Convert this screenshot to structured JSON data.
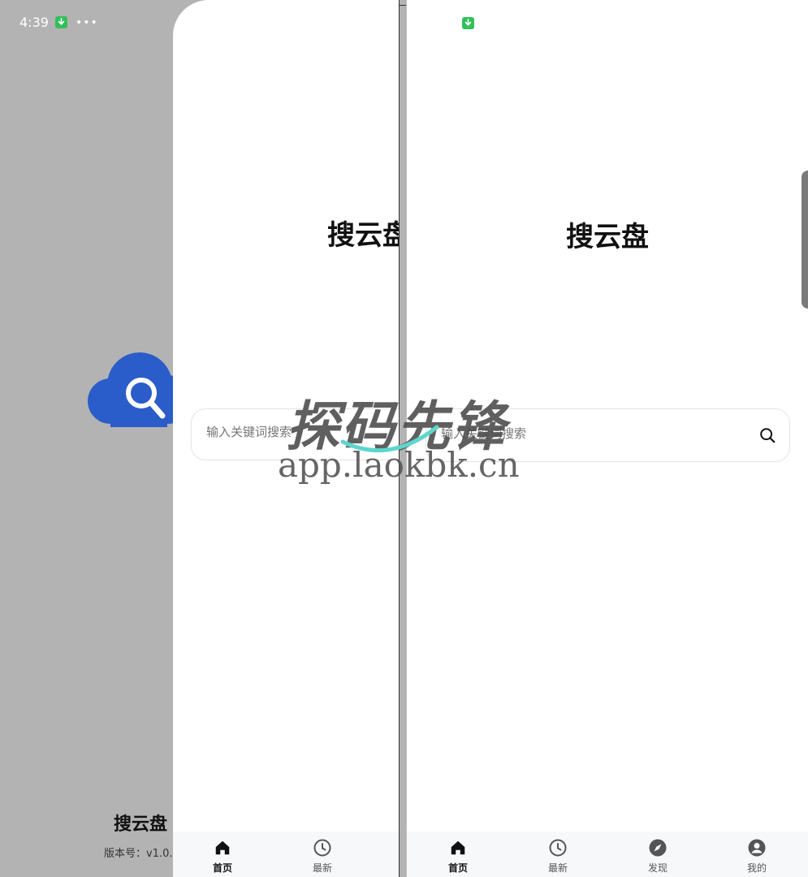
{
  "status_bar": {
    "time": "4:39",
    "download_icon": "download-icon",
    "more_icon": "more-dots-icon"
  },
  "splash": {
    "app_name": "搜云盘",
    "version_label": "版本号：v1.0.",
    "logo_icon": "cloud-search-icon",
    "logo_color": "#2a5dc9"
  },
  "app": {
    "title": "搜云盘",
    "search": {
      "placeholder": "输入关键词搜索",
      "value": ""
    },
    "nav": [
      {
        "label": "首页",
        "icon": "home-icon"
      },
      {
        "label": "最新",
        "icon": "clock-icon"
      },
      {
        "label": "发现",
        "icon": "compass-icon"
      },
      {
        "label": "我的",
        "icon": "user-icon"
      }
    ]
  },
  "watermark": {
    "text": "探码先锋",
    "url": "app.laokbk.cn"
  },
  "colors": {
    "accent_download": "#32c05a",
    "nav_bg": "#f7f8fa",
    "text": "#111111"
  }
}
